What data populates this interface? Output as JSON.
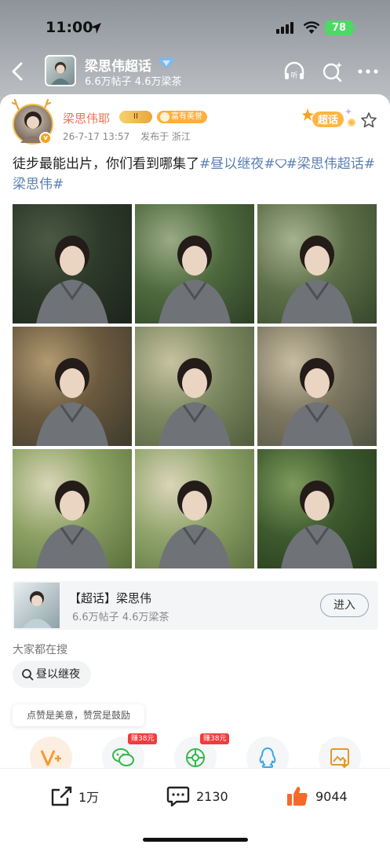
{
  "status_bar": {
    "time": "11:00",
    "battery": "78"
  },
  "header": {
    "title": "梁思伟超话",
    "stats": "6.6万帖子  4.6万梁茶",
    "listen_label": "听"
  },
  "post": {
    "username": "梁思伟耶",
    "level": "II",
    "honor": "富有美誉",
    "verified_mark": "v",
    "time": "26-7-17 13:57",
    "from": "发布于 浙江",
    "tag_label": "超话",
    "text_plain": "徒步最能出片，你们看到哪集了",
    "tag1": "#昼以继夜#",
    "tag2": "#梁思伟超话#",
    "tag2_cont": "梁思伟#"
  },
  "photos": [
    {
      "name": "photo-1",
      "colors": [
        "#2d3a2a",
        "#1c241b",
        "#4b5a44"
      ]
    },
    {
      "name": "photo-2",
      "colors": [
        "#4f6a3e",
        "#2c3f25",
        "#9aaa86"
      ]
    },
    {
      "name": "photo-3",
      "colors": [
        "#5d6f49",
        "#36472b",
        "#a5b38e"
      ]
    },
    {
      "name": "photo-4",
      "colors": [
        "#6b5a3f",
        "#3e3a2c",
        "#b29a72"
      ]
    },
    {
      "name": "photo-5",
      "colors": [
        "#7f8a62",
        "#4f5b3b",
        "#c6c3a0"
      ]
    },
    {
      "name": "photo-6",
      "colors": [
        "#7d7760",
        "#4e5242",
        "#c8bda2"
      ]
    },
    {
      "name": "photo-7",
      "colors": [
        "#8ba062",
        "#5a6f3c",
        "#d9d6b8"
      ]
    },
    {
      "name": "photo-8",
      "colors": [
        "#8fa36a",
        "#5c7040",
        "#dbd5b9"
      ]
    },
    {
      "name": "photo-9",
      "colors": [
        "#3d5a2e",
        "#24371b",
        "#7e9a5c"
      ]
    }
  ],
  "topic_card": {
    "title": "【超话】梁思伟",
    "stats": "6.6万帖子  4.6万梁茶",
    "enter_label": "进入"
  },
  "search": {
    "title": "大家都在搜",
    "chip": "昼以继夜"
  },
  "reward": {
    "tip": "点赞是美意，赞赏是鼓励",
    "badge1": "赚38元",
    "badge2": "赚38元"
  },
  "actions": {
    "share": "1万",
    "comment": "2130",
    "like": "9044"
  },
  "colors": {
    "accent_orange": "#eb7350",
    "link_blue": "#5b7fb5",
    "like_orange": "#f7682a"
  }
}
